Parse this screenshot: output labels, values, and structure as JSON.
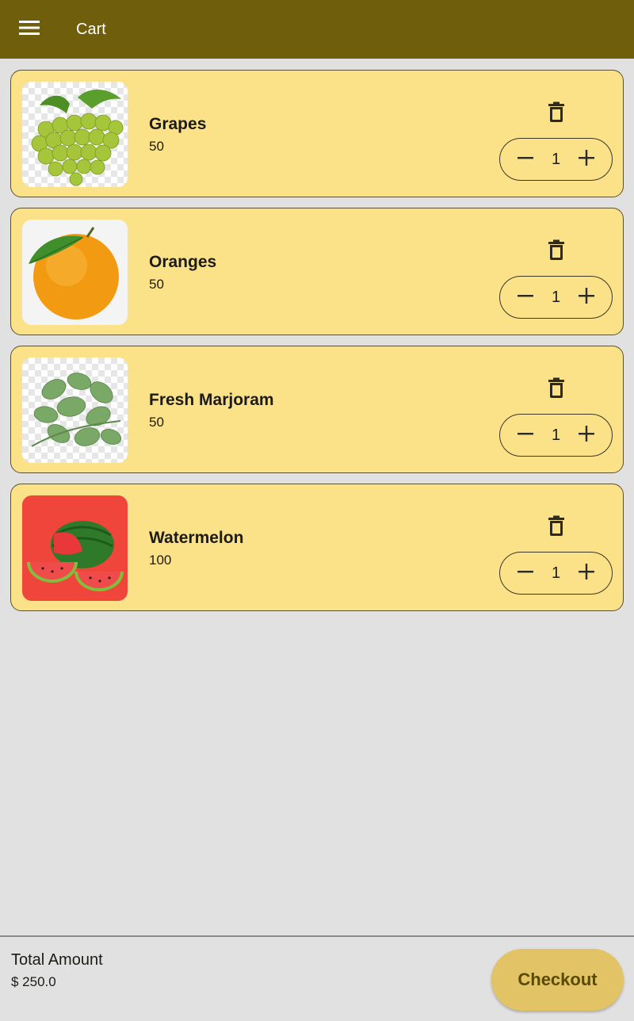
{
  "appbar": {
    "title": "Cart",
    "menu_icon": "menu-icon",
    "color": "#6f5e0c"
  },
  "cart": {
    "items": [
      {
        "name": "Grapes",
        "price": "50",
        "quantity": "1",
        "image": "grapes"
      },
      {
        "name": "Oranges",
        "price": "50",
        "quantity": "1",
        "image": "oranges"
      },
      {
        "name": "Fresh Marjoram",
        "price": "50",
        "quantity": "1",
        "image": "marjoram"
      },
      {
        "name": "Watermelon",
        "price": "100",
        "quantity": "1",
        "image": "watermelon"
      }
    ],
    "card_color": "#fbe289"
  },
  "footer": {
    "total_label": "Total Amount",
    "total_value": "$ 250.0",
    "checkout_label": "Checkout",
    "checkout_color": "#e2c466"
  }
}
